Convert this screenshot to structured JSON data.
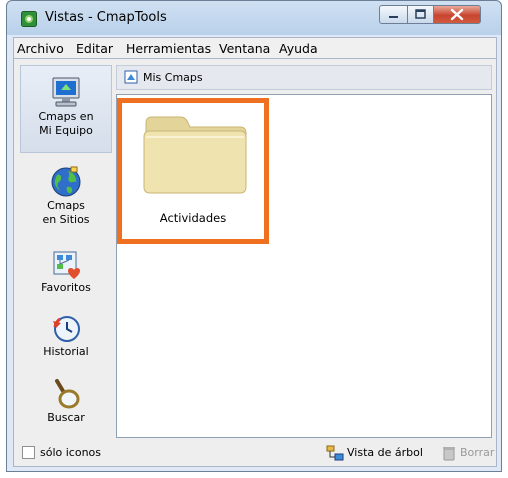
{
  "window": {
    "title": "Vistas - CmapTools",
    "icon": "cmaptools-icon",
    "controls": [
      "minimize-icon",
      "maximize-icon",
      "close-icon"
    ]
  },
  "menu": [
    "Archivo",
    "Editar",
    "Herramientas",
    "Ventana",
    "Ayuda"
  ],
  "sidebar": {
    "items": [
      {
        "line1": "Cmaps en",
        "line2": "Mi Equipo",
        "icon": "computer-icon",
        "selected": true
      },
      {
        "line1": "Cmaps",
        "line2": "en Sitios",
        "icon": "globe-icon",
        "selected": false
      },
      {
        "line1": "Favoritos",
        "line2": "",
        "icon": "favorites-icon",
        "selected": false
      },
      {
        "line1": "Historial",
        "line2": "",
        "icon": "history-icon",
        "selected": false
      },
      {
        "line1": "Buscar",
        "line2": "",
        "icon": "search-icon",
        "selected": false
      }
    ]
  },
  "pathbar": {
    "label": "Mis Cmaps",
    "icon": "cmap-folder-icon"
  },
  "content": {
    "items": [
      {
        "label": "Actividades",
        "icon": "folder-icon",
        "highlighted": true
      }
    ]
  },
  "status": {
    "checkbox_label": "sólo iconos",
    "checkbox_checked": false,
    "tree_view_label": "Vista de árbol",
    "delete_label": "Borrar",
    "delete_enabled": false
  },
  "colors": {
    "highlight_border": "#f07021",
    "folder": "#efe3b0",
    "close_button": "#c7452f"
  }
}
